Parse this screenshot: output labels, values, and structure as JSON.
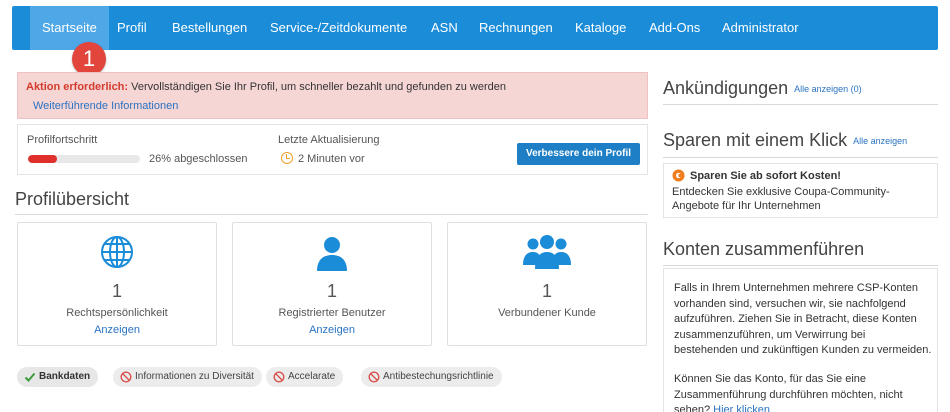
{
  "nav": {
    "items": [
      "Startseite",
      "Profil",
      "Bestellungen",
      "Service-/Zeitdokumente",
      "ASN",
      "Rechnungen",
      "Kataloge",
      "Add-Ons",
      "Administrator"
    ],
    "active": "Startseite",
    "callout_number": "1"
  },
  "alert": {
    "strong": "Aktion erforderlich:",
    "text": " Vervollständigen Sie Ihr Profil, um schneller bezahlt und gefunden zu werden",
    "link": "Weiterführende Informationen"
  },
  "progress": {
    "label": "Profilfortschritt",
    "value": 0.26,
    "text": "26% abgeschlossen",
    "update_label": "Letzte Aktualisierung",
    "update_time": "2 Minuten vor",
    "button": "Verbessere dein Profil"
  },
  "overview": {
    "title": "Profilübersicht",
    "cards": [
      {
        "icon": "globe-icon",
        "count": "1",
        "label": "Rechtspersönlichkeit",
        "link": "Anzeigen"
      },
      {
        "icon": "user-icon",
        "count": "1",
        "label": "Registrierter Benutzer",
        "link": "Anzeigen"
      },
      {
        "icon": "users-group-icon",
        "count": "1",
        "label": "Verbundener Kunde",
        "link": ""
      }
    ]
  },
  "tags": [
    {
      "label": "Bankdaten",
      "status": "complete",
      "icon": "check-icon"
    },
    {
      "label": "Informationen zu Diversität",
      "status": "missing",
      "icon": "prohibited-icon"
    },
    {
      "label": "Accelarate",
      "status": "missing",
      "icon": "prohibited-icon"
    },
    {
      "label": "Antibestechungsrichtlinie",
      "status": "missing",
      "icon": "prohibited-icon"
    }
  ],
  "announcements": {
    "title": "Ankündigungen",
    "link": "Alle anzeigen (0)"
  },
  "save": {
    "title": "Sparen mit einem Klick",
    "link": "Alle anzeigen",
    "headline": "Sparen Sie ab sofort Kosten!",
    "body": "Entdecken Sie exklusive Coupa-Community-Angebote für Ihr Unternehmen"
  },
  "merge": {
    "title": "Konten zusammenführen",
    "p1": "Falls in Ihrem Unternehmen mehrere CSP-Konten vorhanden sind, versuchen wir, sie nachfolgend aufzuführen. Ziehen Sie in Betracht, diese Konten zusammenzuführen, um Verwirrung bei bestehenden und zukünftigen Kunden zu vermeiden.",
    "p2": "Können Sie das Konto, für das Sie eine Zusammenführung durchführen möchten, nicht sehen?",
    "link": "Hier klicken"
  },
  "colors": {
    "nav": "#1a8cd8",
    "nav_active": "#4ea7e6",
    "alert_bg": "#f6d5d5",
    "accent_red": "#e0302b",
    "button": "#1f7fc6",
    "link": "#2a73c2"
  }
}
